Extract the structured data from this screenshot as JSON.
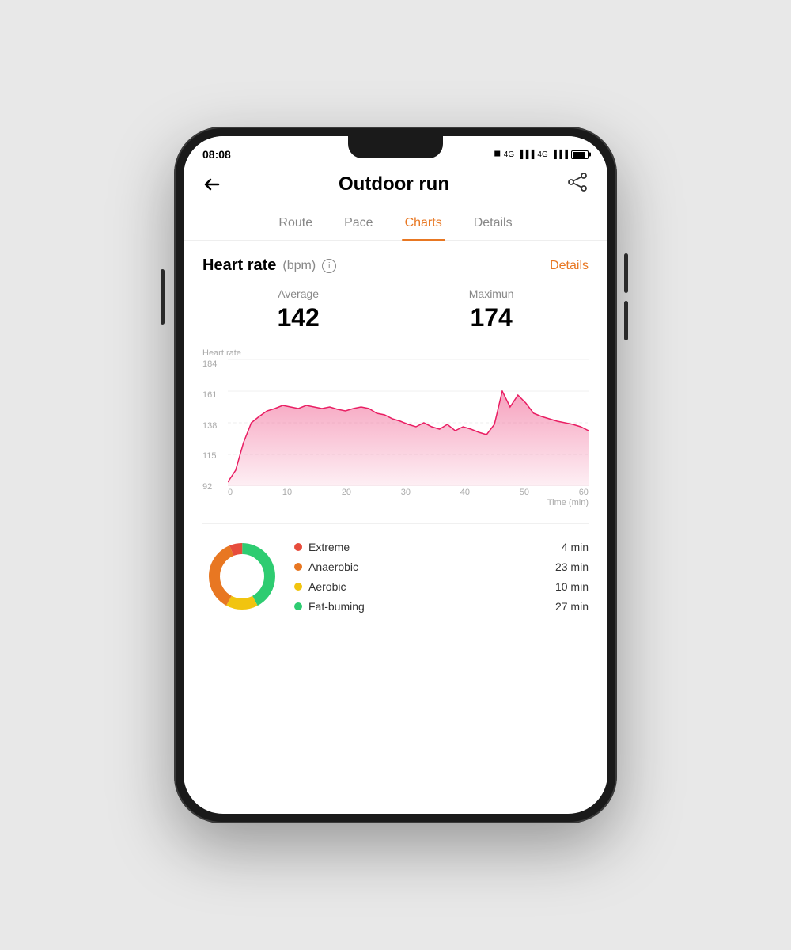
{
  "statusBar": {
    "time": "08:08",
    "batteryLevel": 80
  },
  "header": {
    "title": "Outdoor run",
    "backLabel": "←",
    "shareIcon": "share"
  },
  "tabs": [
    {
      "id": "route",
      "label": "Route",
      "active": false
    },
    {
      "id": "pace",
      "label": "Pace",
      "active": false
    },
    {
      "id": "charts",
      "label": "Charts",
      "active": true
    },
    {
      "id": "details",
      "label": "Details",
      "active": false
    }
  ],
  "heartRateSection": {
    "title": "Heart rate",
    "unit": "(bpm)",
    "detailsLink": "Details",
    "average": {
      "label": "Average",
      "value": "142"
    },
    "maximum": {
      "label": "Maximun",
      "value": "174"
    }
  },
  "chart": {
    "yTitle": "Heart rate",
    "yLabels": [
      "184",
      "161",
      "138",
      "115",
      "92"
    ],
    "xLabels": [
      "0",
      "10",
      "20",
      "30",
      "40",
      "50",
      "60"
    ],
    "xUnit": "Time (min)"
  },
  "legend": {
    "items": [
      {
        "color": "#e74c3c",
        "name": "Extreme",
        "time": "4 min"
      },
      {
        "color": "#e87722",
        "name": "Anaerobic",
        "time": "23 min"
      },
      {
        "color": "#f1c40f",
        "name": "Aerobic",
        "time": "10 min"
      },
      {
        "color": "#2ecc71",
        "name": "Fat-buming",
        "time": "27 min"
      }
    ]
  }
}
